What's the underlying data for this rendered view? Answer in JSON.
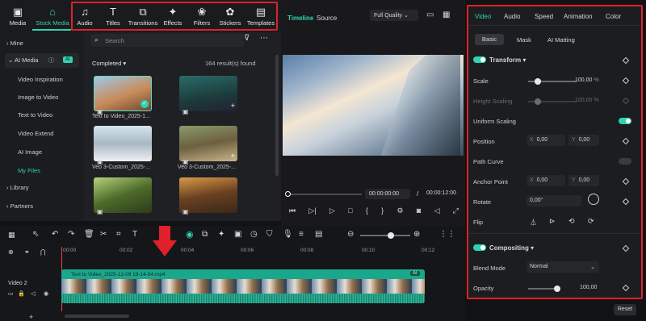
{
  "toolbar": {
    "items": [
      {
        "label": "Media",
        "icon": "media-icon"
      },
      {
        "label": "Stock Media",
        "icon": "stock-media-icon"
      },
      {
        "label": "Audio",
        "icon": "audio-icon"
      },
      {
        "label": "Titles",
        "icon": "titles-icon"
      },
      {
        "label": "Transitions",
        "icon": "transitions-icon"
      },
      {
        "label": "Effects",
        "icon": "effects-icon"
      },
      {
        "label": "Filters",
        "icon": "filters-icon"
      },
      {
        "label": "Stickers",
        "icon": "stickers-icon"
      },
      {
        "label": "Templates",
        "icon": "templates-icon"
      }
    ]
  },
  "sidebar": {
    "items": [
      {
        "label": "Mine"
      },
      {
        "label": "AI Media",
        "badge": "AI"
      },
      {
        "label": "Video Inspiration"
      },
      {
        "label": "Image to Video"
      },
      {
        "label": "Text to Video"
      },
      {
        "label": "Video Extend"
      },
      {
        "label": "AI Image"
      },
      {
        "label": "My Files"
      },
      {
        "label": "Library"
      },
      {
        "label": "Partners"
      }
    ]
  },
  "media": {
    "search_placeholder": "Search",
    "filter_label": "Completed",
    "result_count": "164 result(s) found",
    "thumbs": [
      {
        "caption": "Text to Video_2025-1..."
      },
      {
        "caption": ""
      },
      {
        "caption": "Veo 3-Custom_2025-..."
      },
      {
        "caption": "Veo 3-Custom_2025-..."
      },
      {
        "caption": ""
      },
      {
        "caption": ""
      }
    ]
  },
  "player": {
    "tab_timeline": "Timeline",
    "tab_source": "Source",
    "quality": "Full Quality",
    "current_time": "00:00:00:00",
    "separator": "/",
    "total_time": "00:00:12:00"
  },
  "props": {
    "tabs": [
      "Video",
      "Audio",
      "Speed",
      "Animation",
      "Color"
    ],
    "subtabs": [
      "Basic",
      "Mask",
      "AI Matting"
    ],
    "transform": "Transform",
    "scale_label": "Scale",
    "scale_value": "100,00",
    "scale_unit": "%",
    "height_label": "Height Scaling",
    "height_value": "100,00",
    "height_unit": "%",
    "uniform_label": "Uniform Scaling",
    "position_label": "Position",
    "pos_x_label": "X",
    "pos_x": "0,00",
    "pos_y_label": "Y",
    "pos_y": "0,00",
    "path_label": "Path Curve",
    "anchor_label": "Anchor Point",
    "anc_x_label": "X",
    "anc_x": "0,00",
    "anc_y_label": "Y",
    "anc_y": "0,00",
    "rotate_label": "Rotate",
    "rotate_value": "0,00°",
    "flip_label": "Flip",
    "compositing": "Compositing",
    "blend_label": "Blend Mode",
    "blend_value": "Normal",
    "opacity_label": "Opacity",
    "opacity_value": "100,00",
    "reset": "Reset"
  },
  "timeline": {
    "ruler": [
      "00:00",
      "00:02",
      "00:04",
      "00:06",
      "00:08",
      "00:10",
      "00:12"
    ],
    "track_label": "Video 2",
    "clip_title": "Text to Video_2025-12-09 19-14-54.mp4",
    "clip_badge": "AI"
  },
  "colors": {
    "accent": "#2fd3b0",
    "highlight": "#e0202a"
  }
}
